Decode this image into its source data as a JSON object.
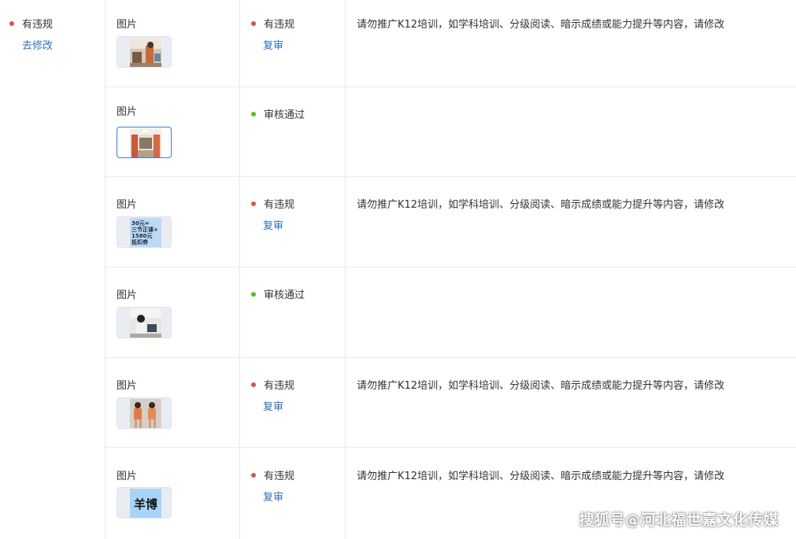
{
  "left_status": {
    "label": "有违规",
    "action": "去修改",
    "dot_color": "#d9534f"
  },
  "colors": {
    "violation": "#d9534f",
    "passed": "#52c41a",
    "link": "#2f6fb5"
  },
  "rows": [
    {
      "type": "图片",
      "thumb_icon": "classroom-photo-icon",
      "status": "有违规",
      "action": "复审",
      "reason": "请勿推广K12培训，如学科培训、分级阅读、暗示成绩或能力提升等内容，请修改"
    },
    {
      "type": "图片",
      "thumb_icon": "room-photo-icon",
      "status": "审核通过",
      "action": "",
      "reason": ""
    },
    {
      "type": "图片",
      "thumb_icon": "coupon-text-image-icon",
      "thumb_text": [
        "30元=",
        "三节正课+",
        "1580元",
        "抵扣券"
      ],
      "status": "有违规",
      "action": "复审",
      "reason": "请勿推广K12培训，如学科培训、分级阅读、暗示成绩或能力提升等内容，请修改"
    },
    {
      "type": "图片",
      "thumb_icon": "student-photo-icon",
      "status": "审核通过",
      "action": "",
      "reason": ""
    },
    {
      "type": "图片",
      "thumb_icon": "dance-photo-icon",
      "status": "有违规",
      "action": "复审",
      "reason": "请勿推广K12培训，如学科培训、分级阅读、暗示成绩或能力提升等内容，请修改"
    },
    {
      "type": "图片",
      "thumb_icon": "logo-text-image-icon",
      "thumb_text": [
        "羊博"
      ],
      "status": "有违规",
      "action": "复审",
      "reason": "请勿推广K12培训，如学科培训、分级阅读、暗示成绩或能力提升等内容，请修改"
    }
  ],
  "watermark": "搜狐号@河北福世嘉文化传媒"
}
